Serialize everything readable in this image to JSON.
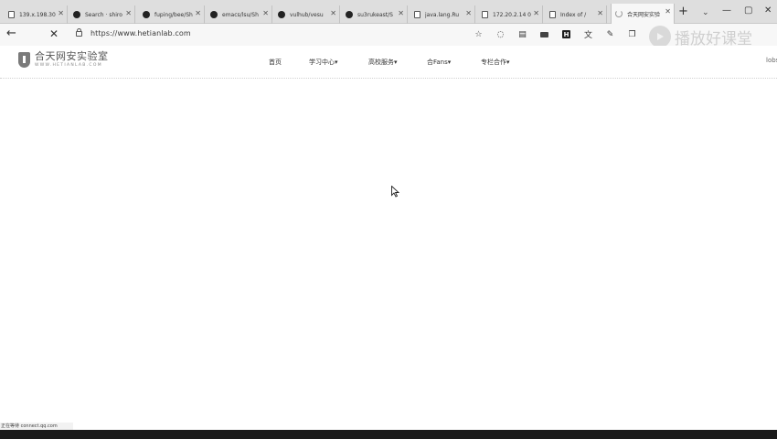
{
  "tabs": [
    {
      "title": "139.x.198.30",
      "icon": "page-icon"
    },
    {
      "title": "Search · shiro",
      "icon": "github-icon"
    },
    {
      "title": "fuping/bee/Sh",
      "icon": "github-icon"
    },
    {
      "title": "emacs/lsu/Sh",
      "icon": "github-icon"
    },
    {
      "title": "vulhub/vesu",
      "icon": "github-icon"
    },
    {
      "title": "su3rukeast/S",
      "icon": "github-icon"
    },
    {
      "title": "java.lang.Ru",
      "icon": "page-icon"
    },
    {
      "title": "172.20.2.14 0",
      "icon": "page-icon"
    },
    {
      "title": "Index of /",
      "icon": "page-icon"
    },
    {
      "title": "合天网安实验",
      "icon": "loading-icon",
      "active": true
    }
  ],
  "toolbar": {
    "url": "https://www.hetianlab.com",
    "watermark": "播放好课堂"
  },
  "site": {
    "logo_name": "合天网安实验室",
    "logo_sub": "WWW.HETIANLAB.COM",
    "nav": [
      "首页",
      "学习中心▾",
      "高校服务▾",
      "合Fans▾",
      "专栏合作▾"
    ],
    "edge_text": "lobs"
  },
  "status_text": "正在等待 connect.qq.com"
}
